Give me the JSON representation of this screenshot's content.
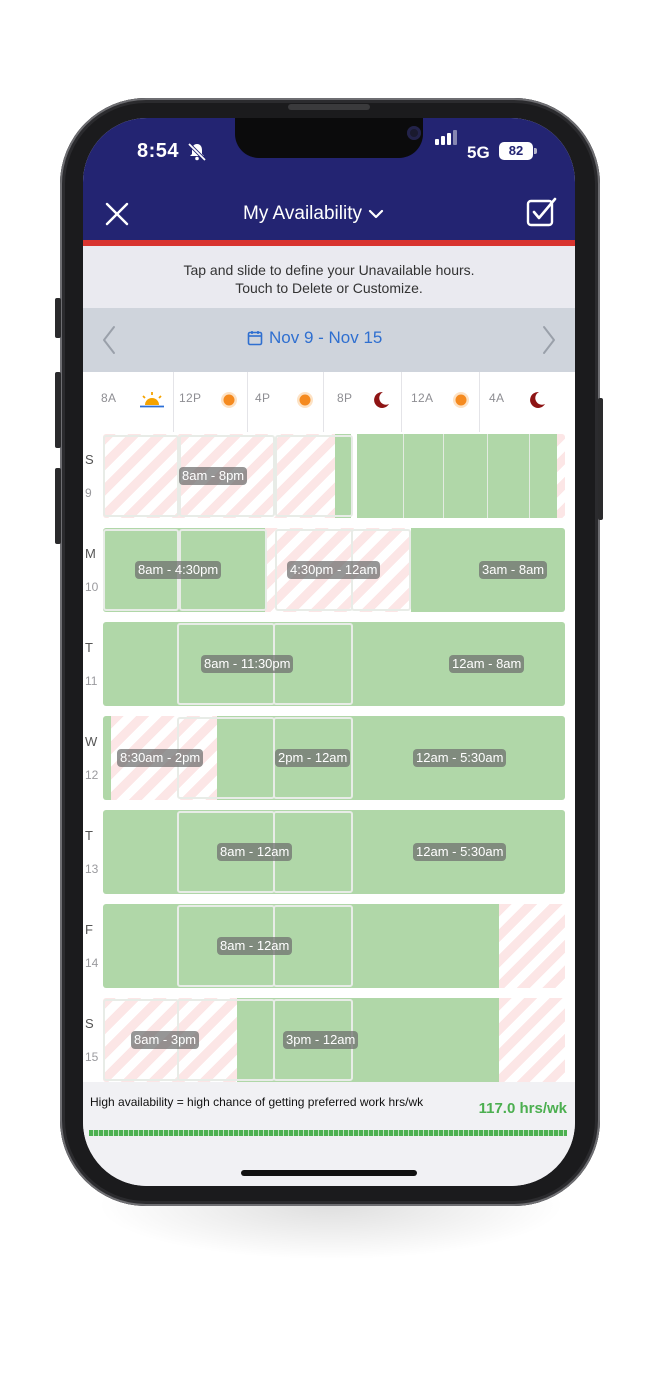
{
  "status_bar": {
    "time": "8:54",
    "network": "5G",
    "battery": "82"
  },
  "header": {
    "title": "My Availability"
  },
  "instructions": {
    "line1": "Tap and slide to define your Unavailable hours.",
    "line2": "Touch to Delete or Customize."
  },
  "week_nav": {
    "label": "Nov 9 - Nov 15"
  },
  "axis": {
    "ticks": [
      "8A",
      "12P",
      "4P",
      "8P",
      "12A",
      "4A"
    ]
  },
  "days": [
    {
      "letter": "S",
      "number": "9",
      "labels": [
        "8am - 8pm"
      ]
    },
    {
      "letter": "M",
      "number": "10",
      "labels": [
        "8am - 4:30pm",
        "4:30pm - 12am",
        "3am - 8am"
      ]
    },
    {
      "letter": "T",
      "number": "11",
      "labels": [
        "8am - 11:30pm",
        "12am - 8am"
      ]
    },
    {
      "letter": "W",
      "number": "12",
      "labels": [
        "8:30am - 2pm",
        "2pm - 12am",
        "12am - 5:30am"
      ]
    },
    {
      "letter": "T",
      "number": "13",
      "labels": [
        "8am - 12am",
        "12am - 5:30am"
      ]
    },
    {
      "letter": "F",
      "number": "14",
      "labels": [
        "8am - 12am"
      ]
    },
    {
      "letter": "S",
      "number": "15",
      "labels": [
        "8am - 3pm",
        "3pm - 12am"
      ]
    }
  ],
  "footer": {
    "message": "High availability = high chance of getting preferred work hrs/wk",
    "total": "117.0 hrs/wk",
    "availability_fraction": 1.0
  },
  "colors": {
    "header": "#232472",
    "accent_red": "#d8342f",
    "available": "#b0d7a8",
    "link_blue": "#2f6fd0",
    "total_green": "#4caf50"
  }
}
